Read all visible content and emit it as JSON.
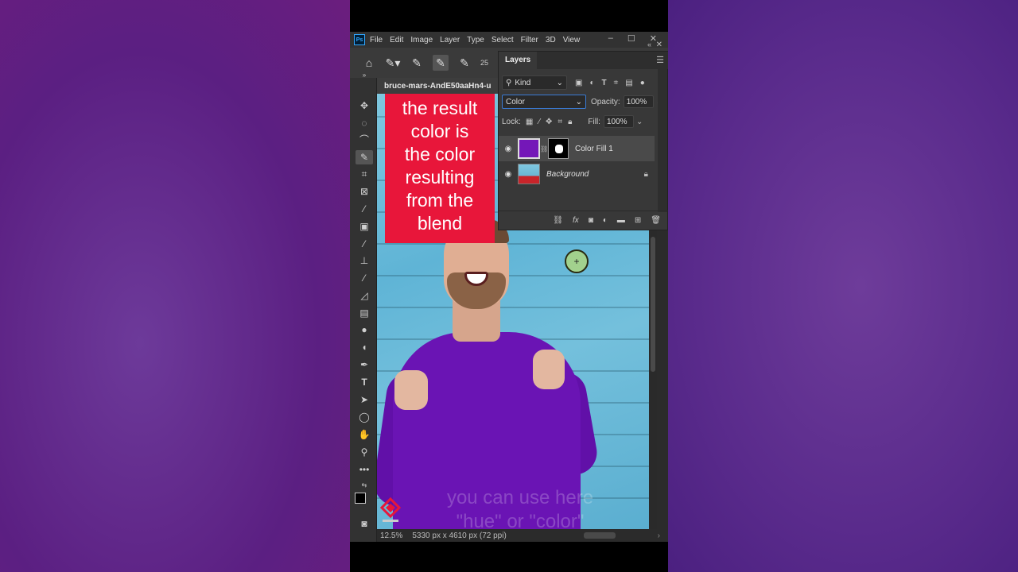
{
  "menu": {
    "app_icon": "Ps",
    "items": [
      "File",
      "Edit",
      "Image",
      "Layer",
      "Type",
      "Select",
      "Filter",
      "3D",
      "View"
    ]
  },
  "document": {
    "tab_title": "bruce-mars-AndE50aaHn4-u"
  },
  "options_bar": {
    "brush_size": "25"
  },
  "layers_panel": {
    "tab_label": "Layers",
    "filter_kind": "Kind",
    "blend_mode": "Color",
    "opacity_label": "Opacity:",
    "opacity_value": "100%",
    "lock_label": "Lock:",
    "fill_label": "Fill:",
    "fill_value": "100%",
    "layers": [
      {
        "name": "Color Fill 1",
        "selected": true,
        "visible": true,
        "thumb_color": "#7417b8",
        "has_mask": true
      },
      {
        "name": "Background",
        "selected": false,
        "visible": true,
        "locked": true,
        "italic": true
      }
    ]
  },
  "caption": {
    "lines": [
      "the result",
      "color is",
      "the color",
      "resulting",
      "from the",
      "blend"
    ],
    "background": "#e8163a"
  },
  "subtitle": {
    "line1": "you can use here",
    "line2": "\"hue\" or \"color\""
  },
  "status": {
    "zoom": "12.5%",
    "dimensions": "5330 px x 4610 px (72 ppi)"
  },
  "colors": {
    "accent_blue": "#31a8ff",
    "shirt_purple": "#6a14b4"
  }
}
